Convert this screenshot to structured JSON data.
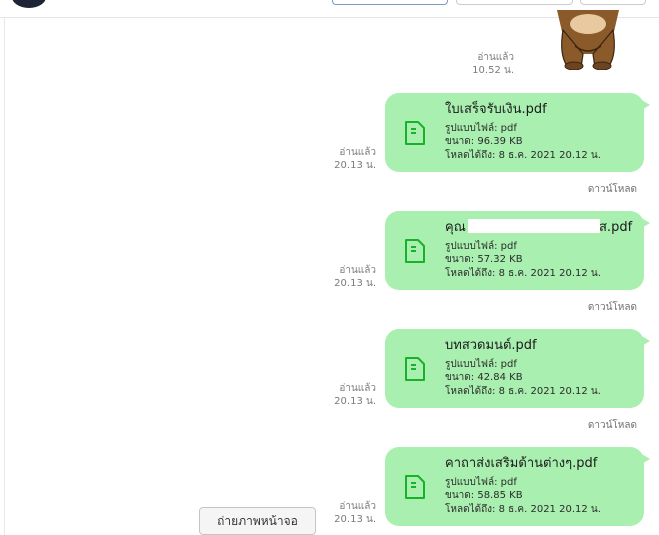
{
  "header": {},
  "sticker": {
    "icon": "bear-sticker-icon"
  },
  "first_read": {
    "label": "อ่านแล้ว",
    "time": "10.52 น."
  },
  "messages": [
    {
      "read_label": "อ่านแล้ว",
      "read_time": "20.13 น.",
      "filename": "ใบเสร็จรับเงิน.pdf",
      "type": "รูปแบบไฟล์: pdf",
      "size": "ขนาด: 96.39 KB",
      "expires": "โหลดได้ถึง: 8 ธ.ค. 2021 20.12 น.",
      "download": "ดาวน์โหลด"
    },
    {
      "read_label": "อ่านแล้ว",
      "read_time": "20.13 น.",
      "filename": "คุณ",
      "filename_tail": "ส.pdf",
      "type": "รูปแบบไฟล์: pdf",
      "size": "ขนาด: 57.32 KB",
      "expires": "โหลดได้ถึง: 8 ธ.ค. 2021 20.12 น.",
      "download": "ดาวน์โหลด"
    },
    {
      "read_label": "อ่านแล้ว",
      "read_time": "20.13 น.",
      "filename": "บทสวดมนต์.pdf",
      "type": "รูปแบบไฟล์: pdf",
      "size": "ขนาด: 42.84 KB",
      "expires": "โหลดได้ถึง: 8 ธ.ค. 2021 20.12 น.",
      "download": "ดาวน์โหลด"
    },
    {
      "read_label": "อ่านแล้ว",
      "read_time": "20.13 น.",
      "filename": "คาถาส่งเสริมด้านต่างๆ.pdf",
      "type": "รูปแบบไฟล์: pdf",
      "size": "ขนาด: 58.85 KB",
      "expires": "โหลดได้ถึง: 8 ธ.ค. 2021 20.12 น."
    }
  ],
  "screenshot_button": "ถ่ายภาพหน้าจอ",
  "colors": {
    "bubble": "#a9efaf",
    "file_icon": "#19b02a"
  }
}
